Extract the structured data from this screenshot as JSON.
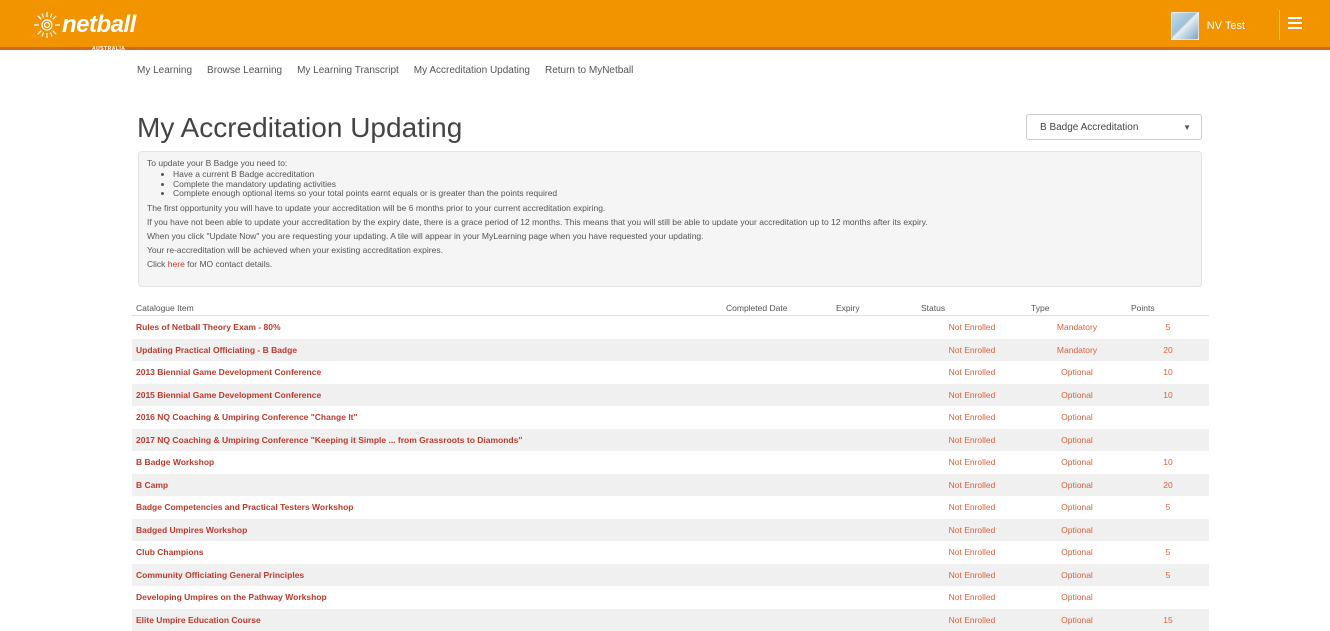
{
  "header": {
    "logo_text": "netball",
    "logo_sub": "AUSTRALIA",
    "user_name": "NV Test",
    "avatar_icon": "user-avatar",
    "menu_icon": "hamburger-menu-icon",
    "brand_color": "#f29400"
  },
  "nav": {
    "items": [
      {
        "label": "My Learning"
      },
      {
        "label": "Browse Learning"
      },
      {
        "label": "My Learning Transcript"
      },
      {
        "label": "My Accreditation Updating"
      },
      {
        "label": "Return to MyNetball"
      }
    ]
  },
  "page": {
    "title": "My Accreditation Updating",
    "accreditation_select": "B Badge Accreditation"
  },
  "info": {
    "intro": "To update your B Badge you need to:",
    "bullets": [
      "Have a current B Badge accreditation",
      "Complete the mandatory updating activities",
      "Complete enough optional items so your total points earnt equals or is greater than the points required"
    ],
    "p1": "The first opportunity you will have to update your accreditation will be 6 months prior to your current accreditation expiring.",
    "p2": "If you have not been able to update your accreditation by the expiry date, there is a grace period of 12 months. This means that you will still be able to update your accreditation up to 12 months after its expiry.",
    "p3": "When you click \"Update Now\" you are requesting your updating. A tile will appear in your MyLearning page when you have requested your updating.",
    "p4": "Your re-accreditation will be achieved when your existing accreditation expires.",
    "click_pre": "Click ",
    "click_link": "here",
    "click_post": " for MO contact details."
  },
  "table": {
    "headers": {
      "item": "Catalogue Item",
      "completed": "Completed Date",
      "expiry": "Expiry",
      "status": "Status",
      "type": "Type",
      "points": "Points"
    },
    "rows": [
      {
        "item": "Rules of Netball Theory Exam - 80%",
        "completed": "",
        "expiry": "",
        "status": "Not Enrolled",
        "type": "Mandatory",
        "points": "5"
      },
      {
        "item": "Updating Practical Officiating - B Badge",
        "completed": "",
        "expiry": "",
        "status": "Not Enrolled",
        "type": "Mandatory",
        "points": "20"
      },
      {
        "item": "2013 Biennial Game Development Conference",
        "completed": "",
        "expiry": "",
        "status": "Not Enrolled",
        "type": "Optional",
        "points": "10"
      },
      {
        "item": "2015 Biennial Game Development Conference",
        "completed": "",
        "expiry": "",
        "status": "Not Enrolled",
        "type": "Optional",
        "points": "10"
      },
      {
        "item": "2016 NQ Coaching & Umpiring Conference \"Change It\"",
        "completed": "",
        "expiry": "",
        "status": "Not Enrolled",
        "type": "Optional",
        "points": ""
      },
      {
        "item": "2017 NQ Coaching & Umpiring Conference \"Keeping it Simple ... from Grassroots to Diamonds\"",
        "completed": "",
        "expiry": "",
        "status": "Not Enrolled",
        "type": "Optional",
        "points": ""
      },
      {
        "item": "B Badge Workshop",
        "completed": "",
        "expiry": "",
        "status": "Not Enrolled",
        "type": "Optional",
        "points": "10"
      },
      {
        "item": "B Camp",
        "completed": "",
        "expiry": "",
        "status": "Not Enrolled",
        "type": "Optional",
        "points": "20"
      },
      {
        "item": "Badge Competencies and Practical Testers Workshop",
        "completed": "",
        "expiry": "",
        "status": "Not Enrolled",
        "type": "Optional",
        "points": "5"
      },
      {
        "item": "Badged Umpires Workshop",
        "completed": "",
        "expiry": "",
        "status": "Not Enrolled",
        "type": "Optional",
        "points": ""
      },
      {
        "item": "Club Champions",
        "completed": "",
        "expiry": "",
        "status": "Not Enrolled",
        "type": "Optional",
        "points": "5"
      },
      {
        "item": "Community Officiating General Principles",
        "completed": "",
        "expiry": "",
        "status": "Not Enrolled",
        "type": "Optional",
        "points": "5"
      },
      {
        "item": "Developing Umpires on the Pathway Workshop",
        "completed": "",
        "expiry": "",
        "status": "Not Enrolled",
        "type": "Optional",
        "points": ""
      },
      {
        "item": "Elite Umpire Education Course",
        "completed": "",
        "expiry": "",
        "status": "Not Enrolled",
        "type": "Optional",
        "points": "15"
      }
    ]
  }
}
